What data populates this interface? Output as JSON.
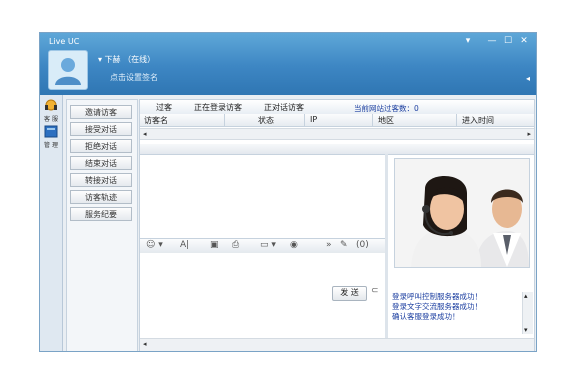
{
  "window": {
    "app_title": "Live UC",
    "user_status": "▾ 下赫 （在线）",
    "signature": "点击设置签名",
    "controls": [
      "▾",
      "—",
      "☐",
      "✕"
    ]
  },
  "leftbar": {
    "items": [
      {
        "label": "客 服",
        "icon": "headset-icon"
      },
      {
        "label": "管 理",
        "icon": "book-icon"
      }
    ]
  },
  "menu": {
    "items": [
      "邀请访客",
      "接受对话",
      "拒绝对话",
      "结束对话",
      "转接对话",
      "访客轨迹",
      "服务纪要"
    ]
  },
  "tabs": [
    "过客",
    "正在登录访客",
    "正对话访客"
  ],
  "visitor_count": "当前网站过客数：0",
  "columns": [
    "访客名",
    "状态",
    "IP",
    "地区",
    "进入时间"
  ],
  "toolbar": {
    "icons": [
      "smiley-icon",
      "font-icon",
      "save-icon",
      "print-icon",
      "screenshot-icon",
      "record-icon",
      "more-icon",
      "file-icon",
      "sound-icon"
    ],
    "glyphs": [
      "☺ ▾",
      "A|",
      "▣",
      "⎙",
      "▭ ▾",
      "◉",
      "»",
      "✎",
      "(0)"
    ]
  },
  "send_button": "发 送",
  "log": [
    "登录呼叫控制服务器成功！",
    "登录文字交流服务器成功！",
    "确认客服登录成功！"
  ],
  "colors": {
    "title_bar": "#3d86c3",
    "log_text": "#1c3fa0"
  }
}
